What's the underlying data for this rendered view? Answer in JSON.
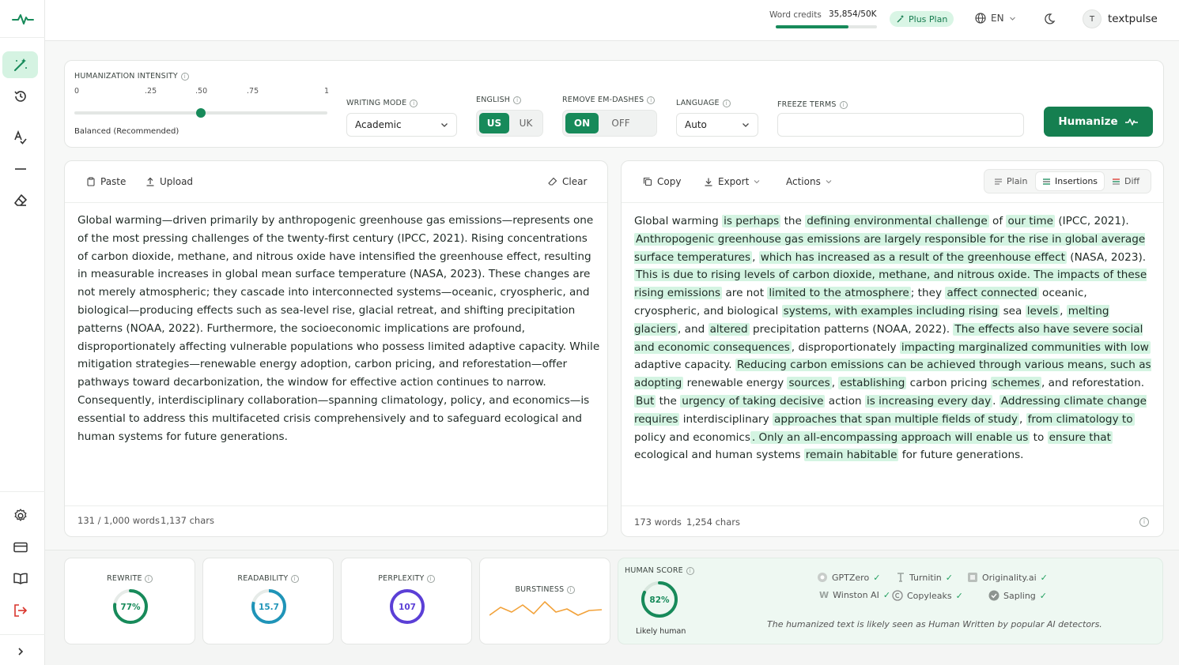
{
  "topbar": {
    "credits_label": "Word credits",
    "credits_value": "35,854/50K",
    "credits_fraction": 0.717,
    "plan_label": "Plus Plan",
    "language": "EN",
    "user_initial": "T",
    "user_name": "textpulse"
  },
  "controls": {
    "intensity_label": "HUMANIZATION INTENSITY",
    "ticks": [
      "0",
      ".25",
      ".50",
      ".75",
      "1"
    ],
    "intensity_value": 0.5,
    "intensity_caption": "Balanced (Recommended)",
    "writing_mode_label": "WRITING MODE",
    "writing_mode_value": "Academic",
    "english_label": "ENGLISH",
    "english_on": "US",
    "english_off": "UK",
    "dashes_label": "REMOVE EM-DASHES",
    "dashes_on": "ON",
    "dashes_off": "OFF",
    "language_label": "LANGUAGE",
    "language_value": "Auto",
    "freeze_label": "FREEZE TERMS",
    "freeze_value": "",
    "humanize_label": "Humanize"
  },
  "input": {
    "paste": "Paste",
    "upload": "Upload",
    "clear": "Clear",
    "text": "Global warming—driven primarily by anthropogenic greenhouse gas emissions—represents one of the most pressing challenges of the twenty-first century (IPCC, 2021). Rising concentrations of carbon dioxide, methane, and nitrous oxide have intensified the greenhouse effect, resulting in measurable increases in global mean surface temperature (NASA, 2023). These changes are not merely atmospheric; they cascade into interconnected systems—oceanic, cryospheric, and biological—producing effects such as sea-level rise, glacial retreat, and shifting precipitation patterns (NOAA, 2022). Furthermore, the socioeconomic implications are profound, disproportionately affecting vulnerable populations who possess limited adaptive capacity. While mitigation strategies—renewable energy adoption, carbon pricing, and reforestation—offer pathways toward decarbonization, the window for effective action continues to narrow. Consequently, interdisciplinary collaboration—spanning climatology, policy, and economics—is essential to address this multifaceted crisis comprehensively and to safeguard ecological and human systems for future generations.",
    "word_count": "131 / 1,000 words",
    "char_count": "1,137 chars"
  },
  "output": {
    "copy": "Copy",
    "export": "Export",
    "actions": "Actions",
    "view_plain": "Plain",
    "view_insertions": "Insertions",
    "view_diff": "Diff",
    "segments": [
      {
        "t": "Global warming ",
        "h": false
      },
      {
        "t": "is perhaps",
        "h": true
      },
      {
        "t": " the ",
        "h": false
      },
      {
        "t": "defining environmental challenge",
        "h": true
      },
      {
        "t": " of ",
        "h": false
      },
      {
        "t": "our time",
        "h": true
      },
      {
        "t": " (IPCC, 2021). ",
        "h": false
      },
      {
        "t": "Anthropogenic greenhouse gas emissions are largely responsible for the rise in global average surface temperatures",
        "h": true
      },
      {
        "t": ", ",
        "h": false
      },
      {
        "t": "which has increased as a result of the greenhouse effect",
        "h": true
      },
      {
        "t": " (NASA, 2023). ",
        "h": false
      },
      {
        "t": "This is due to rising levels of carbon dioxide, methane, and nitrous oxide. The impacts of these rising emissions",
        "h": true
      },
      {
        "t": " are not ",
        "h": false
      },
      {
        "t": "limited to the atmosphere",
        "h": true
      },
      {
        "t": "; they ",
        "h": false
      },
      {
        "t": "affect connected",
        "h": true
      },
      {
        "t": " oceanic, cryospheric, and biological ",
        "h": false
      },
      {
        "t": "systems, with examples including rising",
        "h": true
      },
      {
        "t": " sea ",
        "h": false
      },
      {
        "t": "levels",
        "h": true
      },
      {
        "t": ", ",
        "h": false
      },
      {
        "t": "melting glaciers",
        "h": true
      },
      {
        "t": ", and ",
        "h": false
      },
      {
        "t": "altered",
        "h": true
      },
      {
        "t": " precipitation patterns (NOAA, 2022). ",
        "h": false
      },
      {
        "t": "The effects also have severe social and economic consequences",
        "h": true
      },
      {
        "t": ", disproportionately ",
        "h": false
      },
      {
        "t": "impacting marginalized communities with low",
        "h": true
      },
      {
        "t": " adaptive capacity. ",
        "h": false
      },
      {
        "t": "Reducing carbon emissions can be achieved through various means, such as adopting",
        "h": true
      },
      {
        "t": " renewable energy ",
        "h": false
      },
      {
        "t": "sources",
        "h": true
      },
      {
        "t": ", ",
        "h": false
      },
      {
        "t": "establishing",
        "h": true
      },
      {
        "t": " carbon pricing ",
        "h": false
      },
      {
        "t": "schemes",
        "h": true
      },
      {
        "t": ", and reforestation. ",
        "h": false
      },
      {
        "t": "But",
        "h": true
      },
      {
        "t": " the ",
        "h": false
      },
      {
        "t": "urgency of taking decisive",
        "h": true
      },
      {
        "t": " action ",
        "h": false
      },
      {
        "t": "is increasing every day",
        "h": true
      },
      {
        "t": ". ",
        "h": false
      },
      {
        "t": "Addressing climate change requires",
        "h": true
      },
      {
        "t": " interdisciplinary ",
        "h": false
      },
      {
        "t": "approaches that span multiple fields of study",
        "h": true
      },
      {
        "t": ", ",
        "h": false
      },
      {
        "t": "from climatology to",
        "h": true
      },
      {
        "t": " policy and economics",
        "h": false
      },
      {
        "t": ". Only an all-encompassing approach will enable us",
        "h": true
      },
      {
        "t": " to ",
        "h": false
      },
      {
        "t": "ensure that",
        "h": true
      },
      {
        "t": " ecological and human systems ",
        "h": false
      },
      {
        "t": "remain habitable",
        "h": true
      },
      {
        "t": " for future generations.",
        "h": false
      }
    ],
    "word_count": "173 words",
    "char_count": "1,254 chars"
  },
  "metrics": {
    "rewrite_label": "REWRITE",
    "rewrite_value": "77%",
    "rewrite_fraction": 0.77,
    "readability_label": "READABILITY",
    "readability_value": "15.7",
    "perplexity_label": "PERPLEXITY",
    "perplexity_value": "107",
    "burstiness_label": "BURSTINESS",
    "human_score_label": "HUMAN SCORE",
    "human_score_value": "82%",
    "human_score_fraction": 0.82,
    "human_score_caption": "Likely human",
    "detectors": [
      "GPTZero",
      "Turnitin",
      "Originality.ai",
      "Winston AI",
      "Copyleaks",
      "Sapling"
    ],
    "verdict": "The humanized text is likely seen as Human Written by popular AI detectors."
  },
  "colors": {
    "accent": "#178a5a",
    "highlight": "#d4f4e2",
    "perplexity": "#5b3fd6",
    "readability": "#1f94b8",
    "burstiness": "#f2a23a",
    "logout": "#d9342b"
  }
}
